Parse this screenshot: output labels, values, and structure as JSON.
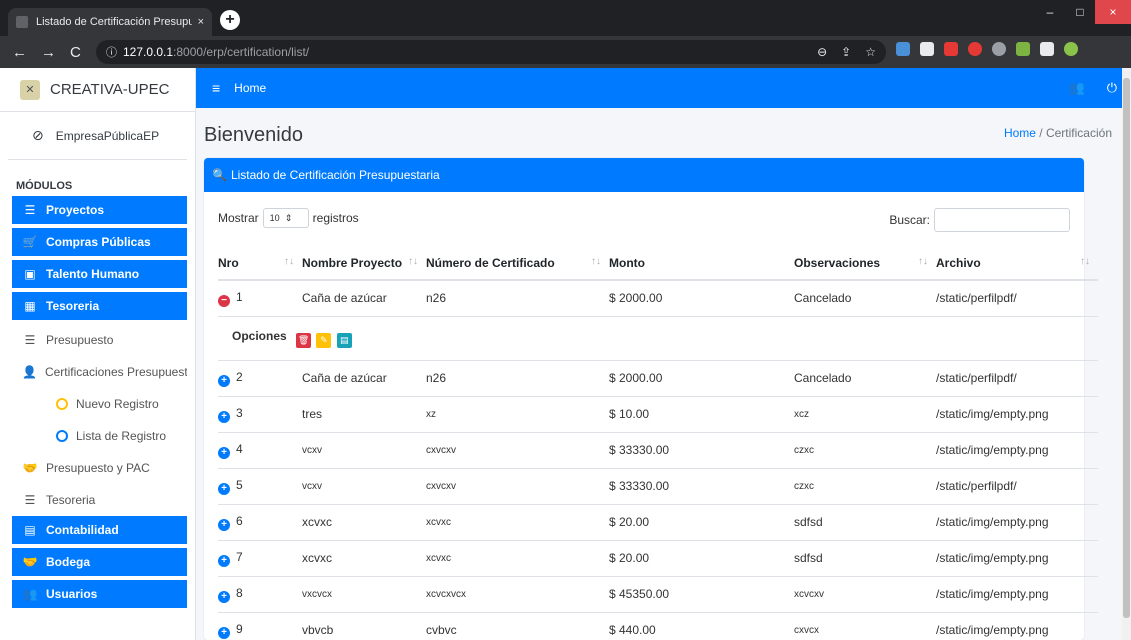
{
  "browser": {
    "tab_title": "Listado de Certificación Presupue",
    "tab_close": "×",
    "new_tab": "+",
    "url_host": "127.0.0.1",
    "url_port_path": ":8000/erp/certification/list/",
    "win_min": "–",
    "win_max": "□",
    "win_close": "×"
  },
  "sidebar": {
    "brand": "CREATIVA-UPEC",
    "company": "EmpresaPúblicaEP",
    "modules_header": "MÓDULOS",
    "items": [
      {
        "label": "Proyectos",
        "icon": "list-icon"
      },
      {
        "label": "Compras Públicas",
        "icon": "cart-icon"
      },
      {
        "label": "Talento Humano",
        "icon": "id-card-icon"
      },
      {
        "label": "Tesoreria",
        "icon": "calendar-icon"
      }
    ],
    "sub_items": [
      {
        "label": "Presupuesto",
        "icon": "list-icon"
      },
      {
        "label": "Certificaciones Presupuestarias",
        "icon": "user-edit-icon"
      }
    ],
    "subsub_items": [
      {
        "label": "Nuevo Registro",
        "color": "#ffc107"
      },
      {
        "label": "Lista de Registro",
        "color": "#007bff"
      }
    ],
    "sub_items2": [
      {
        "label": "Presupuesto y PAC",
        "icon": "handshake-icon"
      },
      {
        "label": "Tesoreria",
        "icon": "list-icon"
      }
    ],
    "items2": [
      {
        "label": "Contabilidad",
        "icon": "book-icon"
      },
      {
        "label": "Bodega",
        "icon": "handshake-icon"
      },
      {
        "label": "Usuarios",
        "icon": "users-icon"
      }
    ]
  },
  "topnav": {
    "home": "Home"
  },
  "page": {
    "title": "Bienvenido",
    "crumb_home": "Home",
    "crumb_sep": " / ",
    "crumb_current": "Certificación"
  },
  "card": {
    "header": "Listado de Certificación Presupuestaria",
    "show_label": "Mostrar",
    "show_value": "10",
    "records_label": "registros",
    "search_label": "Buscar:",
    "options_label": "Opciones"
  },
  "table": {
    "columns": [
      "Nro",
      "Nombre Proyecto",
      "Número de Certificado",
      "Monto",
      "Observaciones",
      "Archivo"
    ],
    "rows": [
      [
        "1",
        "Caña de azúcar",
        "n26",
        "$ 2000.00",
        "Cancelado",
        "/static/perfilpdf/"
      ],
      [
        "2",
        "Caña de azúcar",
        "n26",
        "$ 2000.00",
        "Cancelado",
        "/static/perfilpdf/"
      ],
      [
        "3",
        "tres",
        "xz",
        "$ 10.00",
        "xcz",
        "/static/img/empty.png"
      ],
      [
        "4",
        "vcxv",
        "cxvcxv",
        "$ 33330.00",
        "czxc",
        "/static/img/empty.png"
      ],
      [
        "5",
        "vcxv",
        "cxvcxv",
        "$ 33330.00",
        "czxc",
        "/static/perfilpdf/"
      ],
      [
        "6",
        "xcvxc",
        "xcvxc",
        "$ 20.00",
        "sdfsd",
        "/static/img/empty.png"
      ],
      [
        "7",
        "xcvxc",
        "xcvxc",
        "$ 20.00",
        "sdfsd",
        "/static/img/empty.png"
      ],
      [
        "8",
        "vxcvcx",
        "xcvcxvcx",
        "$ 45350.00",
        "xcvcxv",
        "/static/img/empty.png"
      ],
      [
        "9",
        "vbvcb",
        "cvbvc",
        "$ 440.00",
        "cxvcx",
        "/static/img/empty.png"
      ]
    ]
  }
}
